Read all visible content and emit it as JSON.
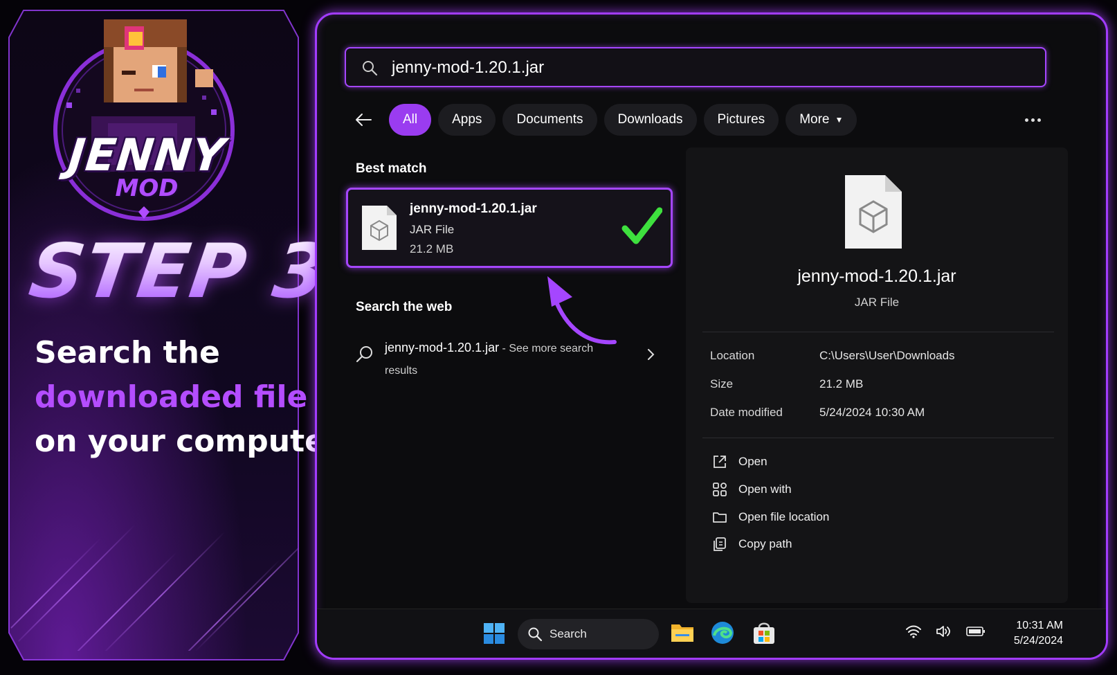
{
  "promo": {
    "logo_title": "JENNY",
    "logo_subtitle": "MOD",
    "step": "STEP 3",
    "desc_line1": "Search the",
    "desc_line2": "downloaded file",
    "desc_line3": "on your computer"
  },
  "search": {
    "query": "jenny-mod-1.20.1.jar",
    "icon": "search-icon"
  },
  "filters": [
    "All",
    "Apps",
    "Documents",
    "Downloads",
    "Pictures",
    "More"
  ],
  "active_filter": "All",
  "best_match": {
    "label": "Best match",
    "name": "jenny-mod-1.20.1.jar",
    "type": "JAR File",
    "size": "21.2 MB"
  },
  "web": {
    "label": "Search the web",
    "query": "jenny-mod-1.20.1.jar",
    "more": " - See more search results"
  },
  "detail": {
    "name": "jenny-mod-1.20.1.jar",
    "type": "JAR File",
    "props": [
      {
        "key": "Location",
        "value": "C:\\Users\\User\\Downloads"
      },
      {
        "key": "Size",
        "value": "21.2 MB"
      },
      {
        "key": "Date modified",
        "value": "5/24/2024 10:30 AM"
      }
    ],
    "actions": [
      "Open",
      "Open with",
      "Open file location",
      "Copy path"
    ]
  },
  "taskbar": {
    "search_label": "Search",
    "time": "10:31 AM",
    "date": "5/24/2024"
  },
  "colors": {
    "accent": "#a546ff",
    "check": "#3ee03e",
    "window_bg": "#0c0c0e"
  }
}
